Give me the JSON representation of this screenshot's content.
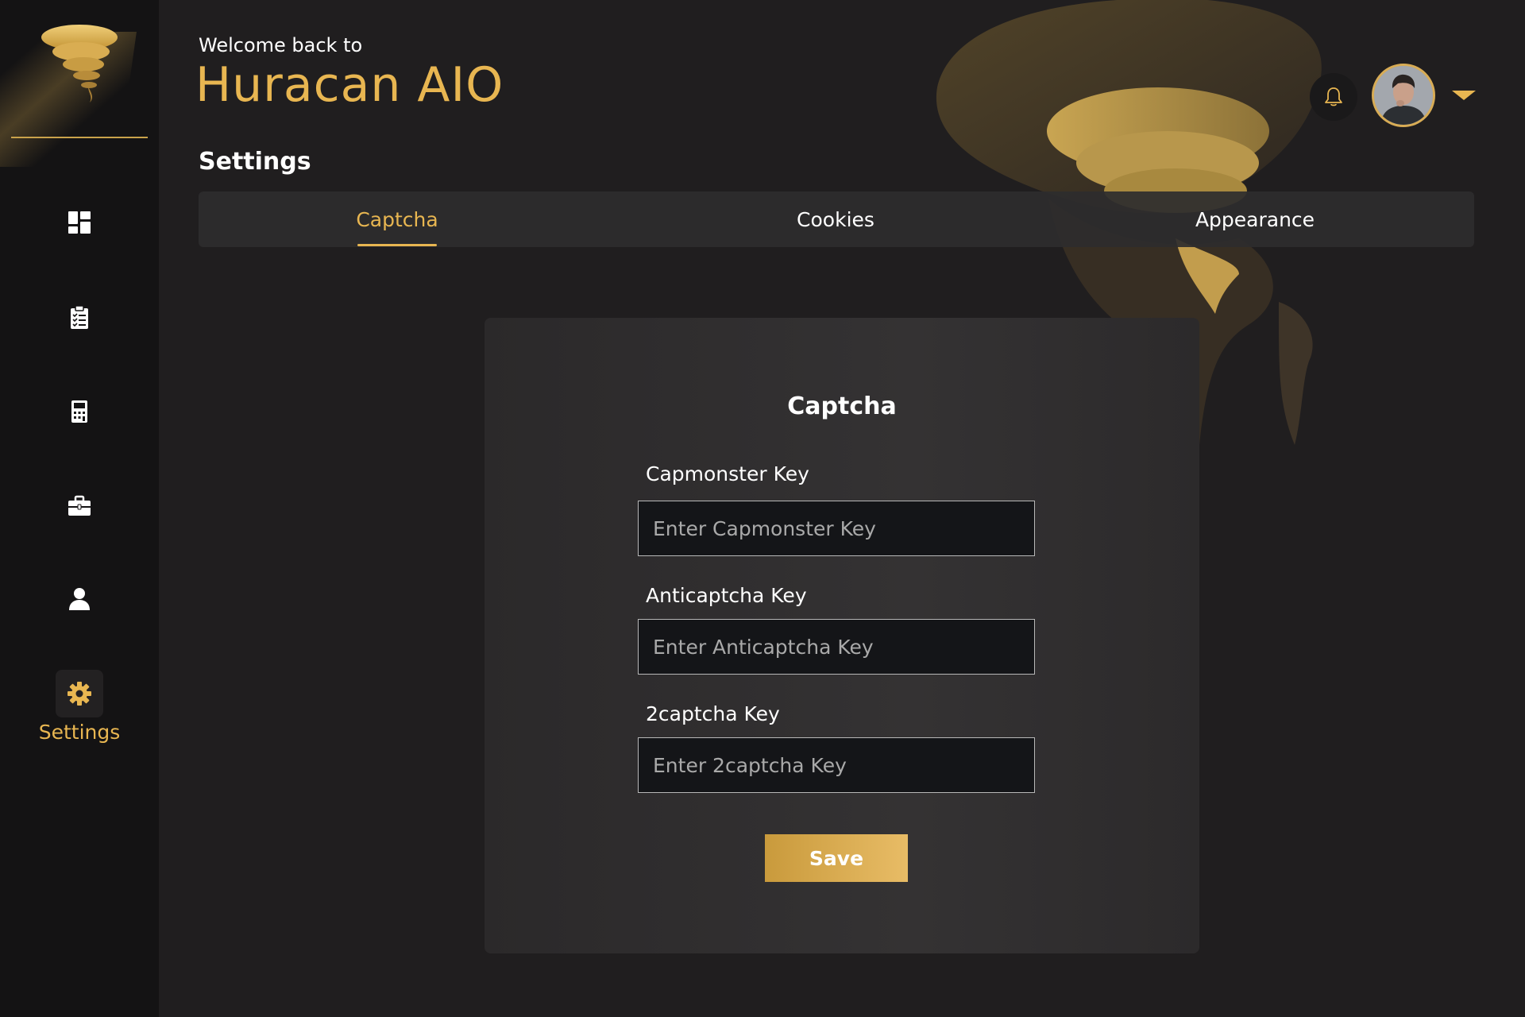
{
  "header": {
    "welcome": "Welcome back to",
    "app_title": "Huracan AIO",
    "section_title": "Settings"
  },
  "sidebar": {
    "items": [
      {
        "icon": "dashboard-icon",
        "label": "",
        "active": false
      },
      {
        "icon": "clipboard-list-icon",
        "label": "",
        "active": false
      },
      {
        "icon": "calculator-icon",
        "label": "",
        "active": false
      },
      {
        "icon": "briefcase-icon",
        "label": "",
        "active": false
      },
      {
        "icon": "user-icon",
        "label": "",
        "active": false
      },
      {
        "icon": "gear-icon",
        "label": "Settings",
        "active": true
      }
    ]
  },
  "tabs": [
    {
      "label": "Captcha",
      "active": true
    },
    {
      "label": "Cookies",
      "active": false
    },
    {
      "label": "Appearance",
      "active": false
    }
  ],
  "card": {
    "title": "Captcha",
    "fields": [
      {
        "label": "Capmonster Key",
        "placeholder": "Enter Capmonster Key",
        "value": ""
      },
      {
        "label": "Anticaptcha Key",
        "placeholder": "Enter Anticaptcha Key",
        "value": ""
      },
      {
        "label": "2captcha Key",
        "placeholder": "Enter 2captcha Key",
        "value": ""
      }
    ],
    "save_label": "Save"
  },
  "colors": {
    "accent": "#e8b651",
    "background": "#201e1f",
    "sidebar": "#141314",
    "card": "#343233"
  }
}
